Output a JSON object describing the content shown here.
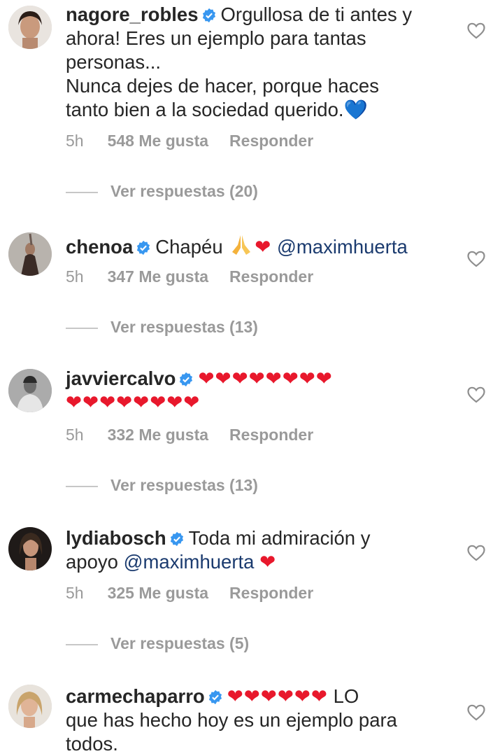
{
  "comments": [
    {
      "username": "nagore_robles",
      "text_lines": [
        "Orgullosa de ti antes y",
        "ahora! Eres un ejemplo para tantas",
        "personas...",
        "Nunca dejes de hacer, porque haces",
        "tanto bien a la sociedad querido."
      ],
      "emoji": "💙",
      "time": "5h",
      "likes": "548 Me gusta",
      "reply": "Responder",
      "view_replies": "Ver respuestas (20)"
    },
    {
      "username": "chenoa",
      "text": "Chapéu",
      "emoji_hearts": "❤",
      "mention": "@maximhuerta",
      "time": "5h",
      "likes": "347 Me gusta",
      "reply": "Responder",
      "view_replies": "Ver respuestas (13)"
    },
    {
      "username": "javviercalvo",
      "hearts_line1": "❤❤❤❤❤❤❤❤",
      "hearts_line2": "❤❤❤❤❤❤❤❤",
      "time": "5h",
      "likes": "332 Me gusta",
      "reply": "Responder",
      "view_replies": "Ver respuestas (13)"
    },
    {
      "username": "lydiabosch",
      "text_line1": "Toda mi admiración y",
      "text_line2": "apoyo",
      "mention": "@maximhuerta",
      "emoji_hearts": "❤",
      "time": "5h",
      "likes": "325 Me gusta",
      "reply": "Responder",
      "view_replies": "Ver respuestas (5)"
    },
    {
      "username": "carmechaparro",
      "hearts": "❤❤❤❤❤❤",
      "text_line1": "LO",
      "text_line2": "que has hecho hoy es un ejemplo para",
      "text_line3": "todos."
    }
  ],
  "colors": {
    "text": "#262626",
    "meta": "#9a9a9a",
    "mention": "#1b3b6f",
    "verified": "#3897f0",
    "heart_red": "#e8182c",
    "heart_blue": "#2f8bf0"
  },
  "icons": [
    "verified-badge-icon",
    "heart-outline-icon",
    "praying-hands-icon"
  ]
}
